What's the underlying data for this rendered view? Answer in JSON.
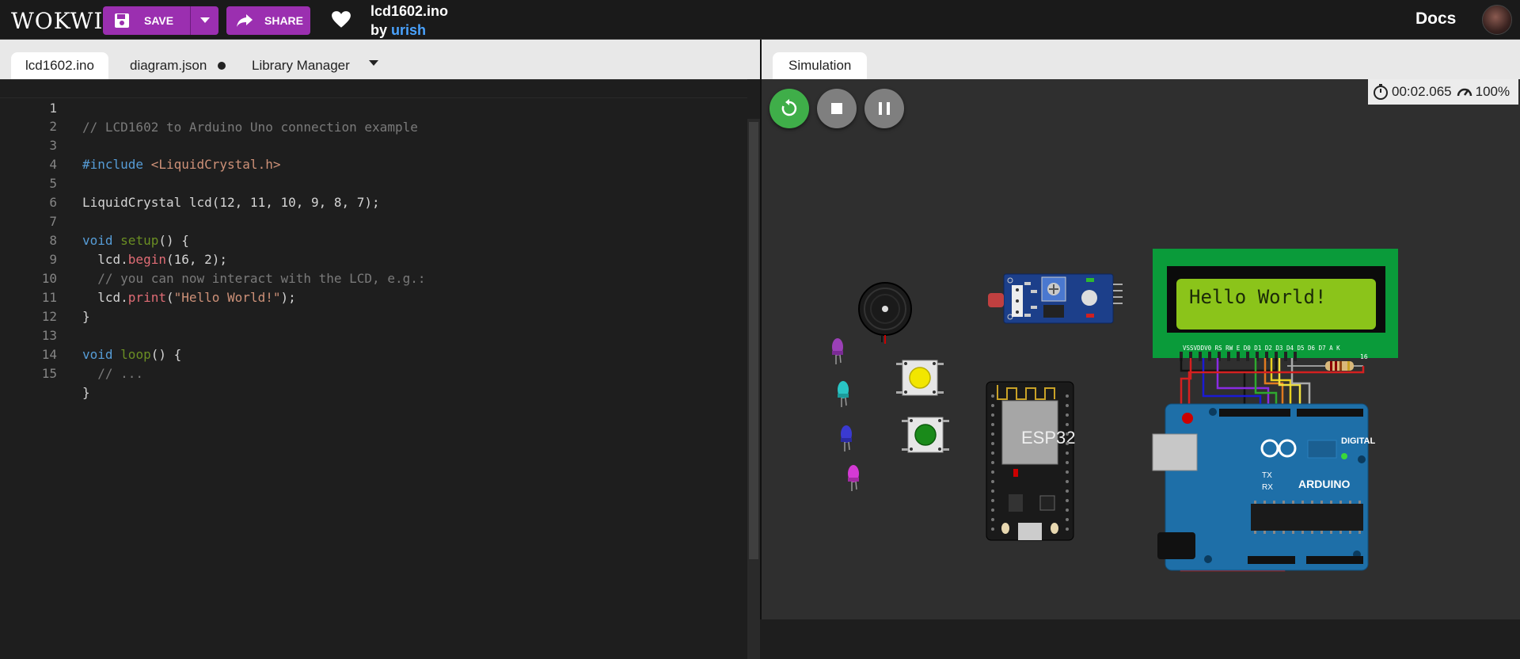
{
  "header": {
    "logo": "WOKWI",
    "save_label": "SAVE",
    "share_label": "SHARE",
    "project_title": "lcd1602.ino",
    "by_prefix": "by",
    "author": "urish",
    "docs_label": "Docs"
  },
  "editor": {
    "tabs": [
      {
        "label": "lcd1602.ino",
        "active": true
      },
      {
        "label": "diagram.json",
        "unsaved": true
      },
      {
        "label": "Library Manager"
      }
    ],
    "lines": [
      "1",
      "2",
      "3",
      "4",
      "5",
      "6",
      "7",
      "8",
      "9",
      "10",
      "11",
      "12",
      "13",
      "14",
      "15"
    ],
    "code": {
      "l1": "// LCD1602 to Arduino Uno connection example",
      "l3_kw": "#include",
      "l3_str": "<LiquidCrystal.h>",
      "l5_type": "LiquidCrystal",
      "l5_rest": " lcd(12, 11, 10, 9, 8, 7);",
      "l7_kw": "void",
      "l7_fn": "setup",
      "l7_rest": "() {",
      "l8_obj": "  lcd.",
      "l8_fn": "begin",
      "l8_rest": "(16, 2);",
      "l9": "  // you can now interact with the LCD, e.g.:",
      "l10_obj": "  lcd.",
      "l10_fn": "print",
      "l10_open": "(",
      "l10_str": "\"Hello World!\"",
      "l10_close": ");",
      "l11": "}",
      "l13_kw": "void",
      "l13_fn": "loop",
      "l13_rest": "() {",
      "l14": "  // ...",
      "l15": "}"
    }
  },
  "simulation": {
    "tab_label": "Simulation",
    "timer": "00:02.065",
    "speed": "100%",
    "lcd_text": "Hello World!",
    "esp32_label": "ESP32",
    "arduino_label": "ARDUINO",
    "digital_label": "DIGITAL",
    "tx_label": "TX",
    "rx_label": "RX",
    "lcd_pins_label": "VSSVDDV0 RS RW  E  D0 D1 D2 D3 D4 D5 D6 D7  A   K",
    "lcd_pin_16": "16"
  }
}
